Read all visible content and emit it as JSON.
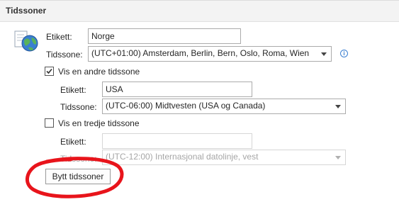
{
  "section": {
    "title": "Tidssoner"
  },
  "primary": {
    "label_text": "Etikett:",
    "label_value": "Norge",
    "timezone_text": "Tidssone:",
    "timezone_value": "(UTC+01:00) Amsterdam, Berlin, Bern, Oslo, Roma, Wien"
  },
  "second": {
    "checkbox_label": "Vis en andre tidssone",
    "checked": true,
    "label_text": "Etikett:",
    "label_value": "USA",
    "timezone_text": "Tidssone:",
    "timezone_value": "(UTC-06:00) Midtvesten (USA og Canada)"
  },
  "third": {
    "checkbox_label": "Vis en tredje tidssone",
    "checked": false,
    "label_text": "Etikett:",
    "label_value": "",
    "timezone_text": "Tidssone:",
    "timezone_value": "(UTC-12:00) Internasjonal datolinje, vest"
  },
  "swap_button": {
    "label": "Bytt tidssoner"
  },
  "colors": {
    "annotation": "#e8141b",
    "checkmark": "#333333",
    "info": "#3b7fd1"
  },
  "icons": {
    "section": "globe-clock-icon",
    "info": "info-icon"
  }
}
